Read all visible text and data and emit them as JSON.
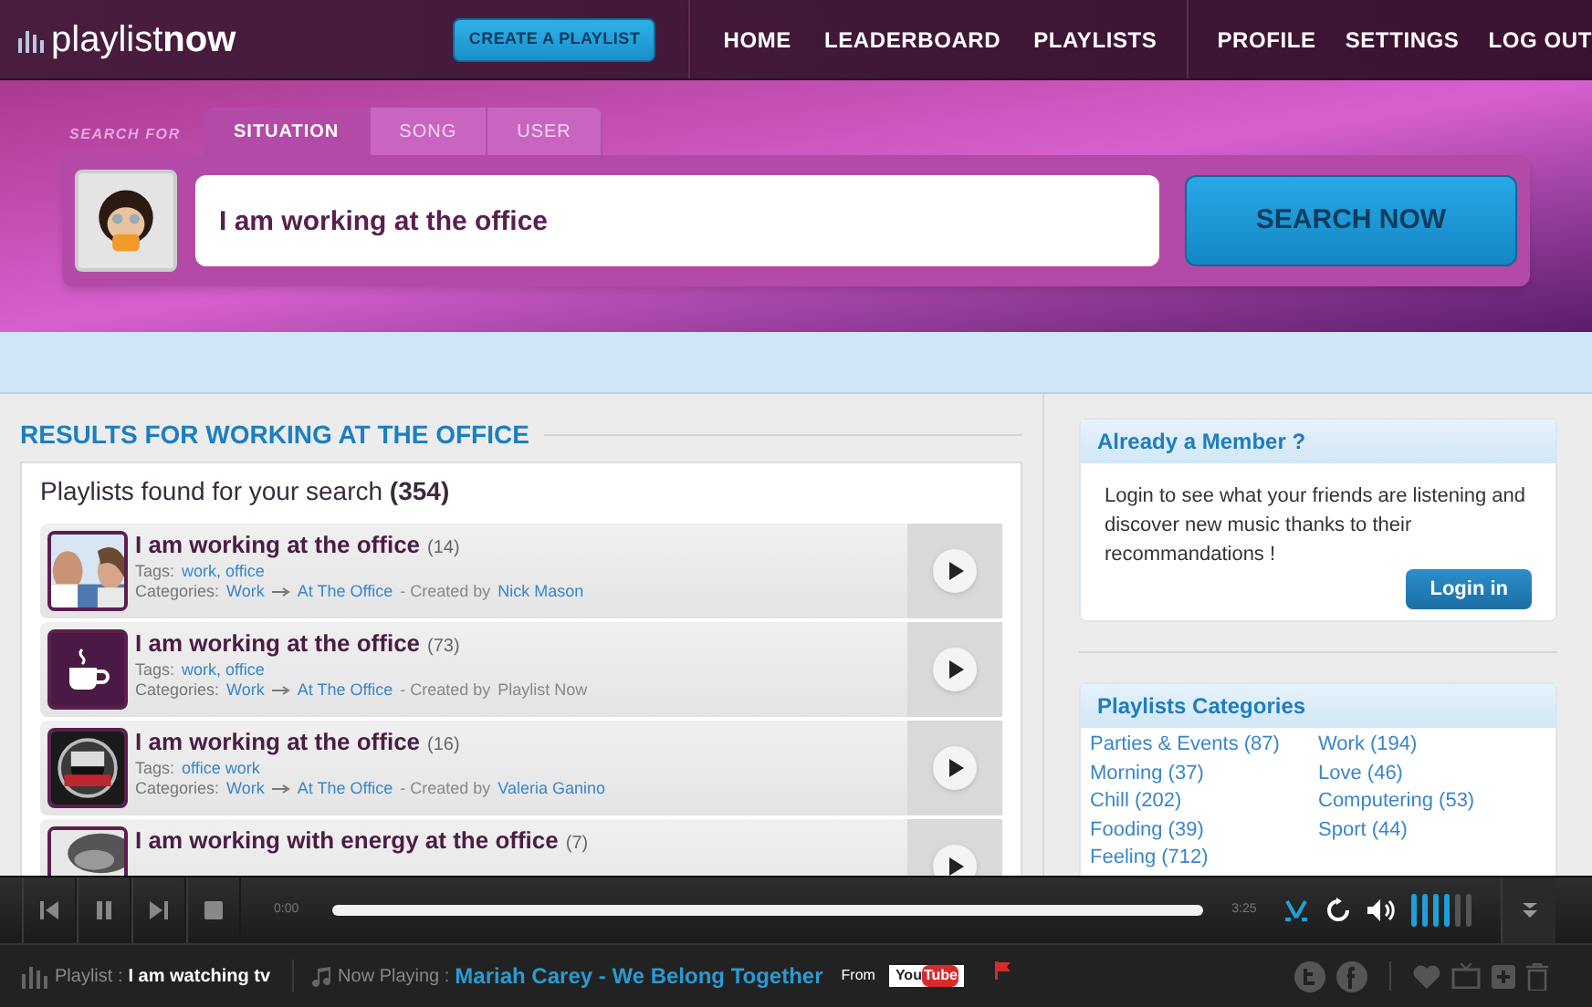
{
  "header": {
    "logo": {
      "light": "playlist",
      "bold": "now"
    },
    "create_button": "CREATE A PLAYLIST",
    "nav": [
      "HOME",
      "LEADERBOARD",
      "PLAYLISTS"
    ],
    "user_nav": [
      "PROFILE",
      "SETTINGS",
      "LOG OUT"
    ]
  },
  "search": {
    "label": "SEARCH FOR",
    "tabs": [
      {
        "label": "SITUATION",
        "selected": true
      },
      {
        "label": "SONG",
        "selected": false
      },
      {
        "label": "USER",
        "selected": false
      }
    ],
    "value": "I am working at the office",
    "button": "SEARCH NOW"
  },
  "results": {
    "heading": "RESULTS FOR WORKING AT THE OFFICE",
    "summary": "Playlists found for your search **(354)**",
    "rows": [
      {
        "kind": "picture",
        "title": "I am working at the office",
        "count": "(14)",
        "tags_label": "Tags:",
        "tags": "work, office",
        "categories_label": "Categories:",
        "categories": [
          "Work",
          "At The Office"
        ],
        "created_label": "- Created by",
        "creator": {
          "name": "Nick Mason",
          "linked": true
        }
      },
      {
        "kind": "icon",
        "title": "I am working at the office",
        "count": "(73)",
        "tags_label": "Tags:",
        "tags": "work, office",
        "categories_label": "Categories:",
        "categories": [
          "Work",
          "At The Office"
        ],
        "created_label": "- Created by",
        "creator": {
          "name": "Playlist Now",
          "linked": false
        }
      },
      {
        "kind": "picture",
        "title": "I am working at the office",
        "count": "(16)",
        "tags_label": "Tags:",
        "tags": "office work",
        "categories_label": "Categories:",
        "categories": [
          "Work",
          "At The Office"
        ],
        "created_label": "- Created by",
        "creator": {
          "name": "Valeria Ganino",
          "linked": true
        }
      },
      {
        "kind": "picture",
        "title": "I am working with energy at the office",
        "count": "(7)"
      }
    ]
  },
  "member": {
    "title": "Already a Member ?",
    "text": "Login to see what your friends are listening and discover new music thanks to their recommandations !",
    "button": "Login in"
  },
  "categories": {
    "title": "Playlists Categories",
    "columns": [
      [
        "Parties & Events (87)",
        "Morning (37)",
        "Chill (202)",
        "Fooding (39)",
        "Feeling (712)"
      ],
      [
        "Work (194)",
        "Love (46)",
        "Computering (53)",
        "Sport (44)"
      ]
    ]
  },
  "player": {
    "elapsed": "0:00",
    "duration": "3:25",
    "volume": {
      "level": 0.67
    }
  },
  "status": {
    "playlist_label": "Playlist :",
    "playlist": "I am watching tv",
    "now_label": "Now Playing :",
    "now": "Mariah Carey - We Belong Together",
    "from_label": "From",
    "source": {
      "a": "You",
      "b": "Tube"
    }
  }
}
